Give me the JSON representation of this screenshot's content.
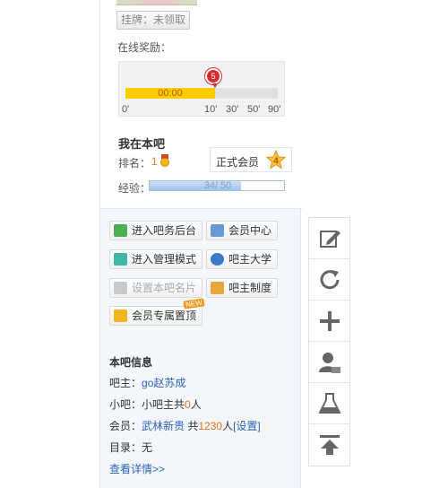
{
  "top": {
    "hang_button": "挂牌：未领取",
    "online_reward_label": "在线奖励：",
    "timer": "00:00",
    "timer_progress_fraction": 0.59,
    "ticks": [
      "0'",
      "10'",
      "30'",
      "50'",
      "90'"
    ],
    "gift_badge": "5"
  },
  "mybar": {
    "title": "我在本吧",
    "rank_label": "排名：",
    "rank_value": "1",
    "member_label": "正式会员",
    "level": "4",
    "exp_label": "经验：",
    "exp_text": "34/ 50",
    "exp_current": 34,
    "exp_max": 50
  },
  "actions": {
    "admin_panel": "进入吧务后台",
    "member_center": "会员中心",
    "manage_mode": "进入管理模式",
    "bazhu_university": "吧主大学",
    "set_bar_card": "设置本吧名片",
    "bazhu_rules": "吧主制度",
    "member_pin": "会员专属置顶",
    "new_tag": "NEW"
  },
  "info": {
    "title": "本吧信息",
    "owner_label": "吧主：",
    "owner_name": "go赵苏成",
    "small_owner_label": "小吧：",
    "small_owner_text_prefix": "小吧主共",
    "small_owner_count": "0",
    "small_owner_text_suffix": "人",
    "member_label": "会员：",
    "member_name": "武林新贵",
    "member_total_prefix": " 共",
    "member_count": "1230",
    "member_total_suffix": "人",
    "member_setting": "[设置]",
    "catalog_label": "目录：",
    "catalog_value": "无",
    "more_link": "查看详情>>"
  },
  "float_bar": [
    "edit-icon",
    "refresh-icon",
    "plus-icon",
    "user-feedback-icon",
    "lab-flask-icon",
    "back-to-top-icon"
  ],
  "colors": {
    "accent_blue": "#2d64b3",
    "accent_orange": "#e0701f",
    "timer_fill": "#ffcc00",
    "gift_red": "#d92b2b"
  }
}
